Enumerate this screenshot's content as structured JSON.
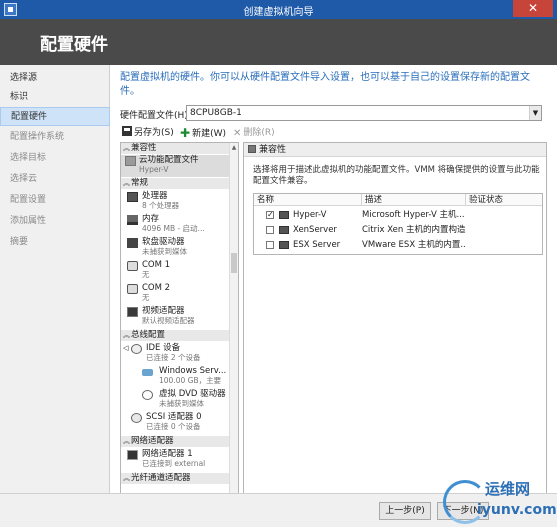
{
  "window": {
    "title": "创建虚拟机向导",
    "close": "✕"
  },
  "header": {
    "title": "配置硬件"
  },
  "nav": {
    "items": [
      {
        "label": "选择源"
      },
      {
        "label": "标识"
      },
      {
        "label": "配置硬件"
      },
      {
        "label": "配置操作系统"
      },
      {
        "label": "选择目标"
      },
      {
        "label": "选择云"
      },
      {
        "label": "配置设置"
      },
      {
        "label": "添加属性"
      },
      {
        "label": "摘要"
      }
    ]
  },
  "main": {
    "intro": "配置虚拟机的硬件。你可以从硬件配置文件导入设置，也可以基于自己的设置保存新的配置文件。",
    "profile_label": "硬件配置文件(H):",
    "profile_value": "8CPU8GB-1",
    "toolbar": {
      "save_as": "另存为(S)",
      "new": "新建(W)",
      "delete": "删除(R)"
    }
  },
  "tree": {
    "sections": [
      {
        "label": "兼容性"
      },
      {
        "label": "常规"
      },
      {
        "label": "总线配置"
      },
      {
        "label": "网络适配器"
      },
      {
        "label": "光纤通道适配器"
      }
    ],
    "items": [
      {
        "t1": "云功能配置文件",
        "t2": "Hyper-V"
      },
      {
        "t1": "处理器",
        "t2": "8 个处理器"
      },
      {
        "t1": "内存",
        "t2": "4096 MB - 启动..."
      },
      {
        "t1": "软盘驱动器",
        "t2": "未捕获到媒体"
      },
      {
        "t1": "COM 1",
        "t2": "无"
      },
      {
        "t1": "COM 2",
        "t2": "无"
      },
      {
        "t1": "视频适配器",
        "t2": "默认视频适配器"
      },
      {
        "t1": "IDE 设备",
        "t2": "已连接 2 个设备"
      },
      {
        "t1": "Windows Serv...",
        "t2": "100.00 GB，主要"
      },
      {
        "t1": "虚拟 DVD 驱动器",
        "t2": "未捕获到媒体"
      },
      {
        "t1": "SCSI 适配器 0",
        "t2": "已连接 0 个设备"
      },
      {
        "t1": "网络适配器 1",
        "t2": "已连接到 external"
      }
    ]
  },
  "detail": {
    "title": "兼容性",
    "description": "选择将用于描述此虚拟机的功能配置文件。VMM 将确保提供的设置与此功能配置文件兼容。",
    "grid": {
      "headers": [
        "名称",
        "描述",
        "验证状态"
      ],
      "rows": [
        {
          "checked": "✓",
          "name": "Hyper-V",
          "desc": "Microsoft Hyper-V 主机..."
        },
        {
          "checked": "",
          "name": "XenServer",
          "desc": "Citrix Xen 主机的内置构造..."
        },
        {
          "checked": "",
          "name": "ESX Server",
          "desc": "VMware ESX 主机的内置..."
        }
      ]
    }
  },
  "footer": {
    "prev": "上一步(P)",
    "next": "下一步(N)"
  },
  "watermark": {
    "line1": "运维网",
    "line2": "iyunv.com"
  }
}
